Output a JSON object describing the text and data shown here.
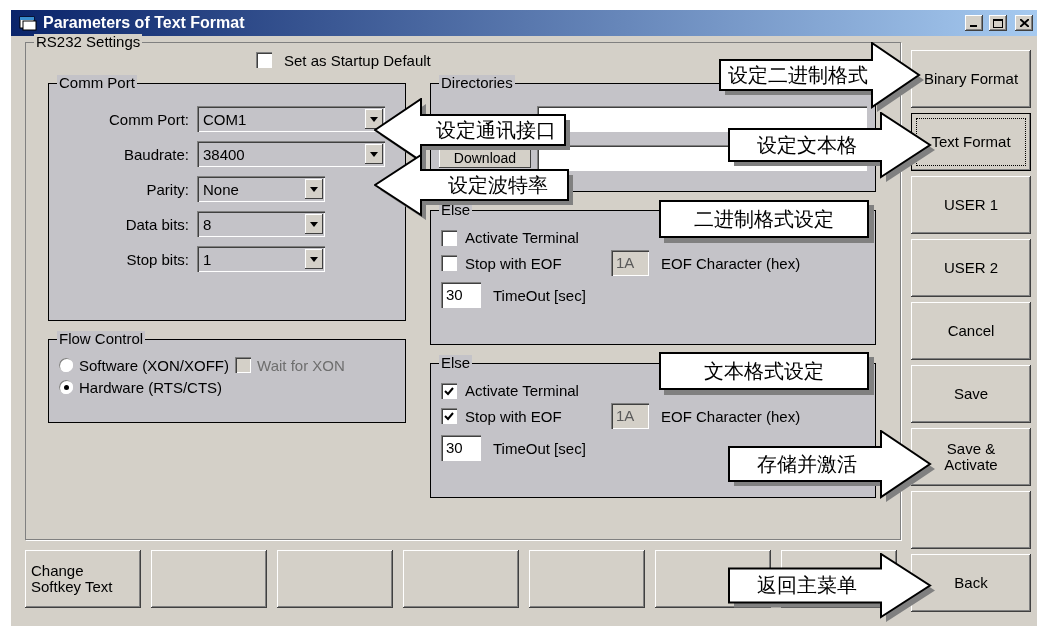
{
  "window": {
    "title": "Parameters of Text Format"
  },
  "rs232": {
    "title": "RS232 Settings",
    "startup_default": {
      "label": "Set  as Startup Default",
      "checked": false
    },
    "comm_port": {
      "title": "Comm Port",
      "fields": [
        {
          "label": "Comm Port:",
          "value": "COM1"
        },
        {
          "label": "Baudrate:",
          "value": "38400"
        },
        {
          "label": "Parity:",
          "value": "None"
        },
        {
          "label": "Data bits:",
          "value": "8"
        },
        {
          "label": "Stop bits:",
          "value": "1"
        }
      ]
    },
    "flow_control": {
      "title": "Flow Control",
      "options": [
        {
          "label": "Software (XON/XOFF)",
          "selected": false
        },
        {
          "label": "Hardware (RTS/CTS)",
          "selected": true
        }
      ],
      "wait_for_xon": {
        "label": "Wait for XON",
        "checked": false,
        "disabled": true
      }
    },
    "directories": {
      "title": "Directories",
      "rows": [
        {
          "kind": "covered"
        },
        {
          "kind": "labeled",
          "label": "Download"
        }
      ]
    },
    "else_groups": [
      {
        "title": "Else",
        "activate_terminal": {
          "label": "Activate Terminal",
          "checked": false
        },
        "stop_eof": {
          "label": "Stop with  EOF",
          "checked": false
        },
        "eof_char": {
          "value": "1A",
          "disabled": true,
          "label": "EOF Character (hex)"
        },
        "timeout": {
          "value": "30",
          "label": "TimeOut [sec]"
        }
      },
      {
        "title": "Else",
        "activate_terminal": {
          "label": "Activate Terminal",
          "checked": true
        },
        "stop_eof": {
          "label": "Stop with  EOF",
          "checked": true
        },
        "eof_char": {
          "value": "1A",
          "disabled": true,
          "label": "EOF Character (hex)"
        },
        "timeout": {
          "value": "30",
          "label": "TimeOut [sec]"
        }
      }
    ]
  },
  "side_buttons": [
    {
      "kind": "text",
      "label": "Binary Format",
      "focused": false
    },
    {
      "kind": "text",
      "label": "Text Format",
      "focused": true
    },
    {
      "kind": "text",
      "label": "USER 1",
      "focused": false
    },
    {
      "kind": "text",
      "label": "USER 2",
      "focused": false
    },
    {
      "kind": "text",
      "label": "Cancel",
      "focused": false
    },
    {
      "kind": "text",
      "label": "Save",
      "focused": false
    },
    {
      "kind": "text",
      "label": "Save &\nActivate",
      "focused": false
    },
    {
      "kind": "blank",
      "focused": false
    },
    {
      "kind": "text",
      "label": "Back",
      "focused": false
    }
  ],
  "softkeys": [
    {
      "kind": "text",
      "label": "Change\nSoftkey Text"
    },
    {
      "kind": "blank"
    },
    {
      "kind": "blank"
    },
    {
      "kind": "blank"
    },
    {
      "kind": "blank"
    },
    {
      "kind": "blank"
    },
    {
      "kind": "blank"
    }
  ],
  "callouts": [
    {
      "kind": "arrow_left",
      "text": "设定通讯接口"
    },
    {
      "kind": "arrow_left",
      "text": "设定波特率"
    },
    {
      "kind": "arrow_right",
      "text": "设定二进制格式"
    },
    {
      "kind": "arrow_right",
      "text": "设定文本格"
    },
    {
      "kind": "plain",
      "text": "二进制格式设定"
    },
    {
      "kind": "plain",
      "text": "文本格式设定"
    },
    {
      "kind": "arrow_right",
      "text": "存储并激活"
    },
    {
      "kind": "arrow_right",
      "text": "返回主菜单"
    }
  ]
}
